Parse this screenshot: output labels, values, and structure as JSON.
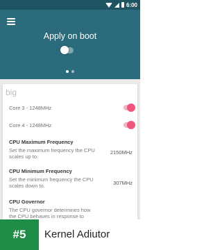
{
  "status_bar": {
    "time": "6:00"
  },
  "header": {
    "title": "Apply on boot"
  },
  "card": {
    "section_title": "big",
    "toggles": [
      {
        "label": "Core 3 - 1248MHz",
        "enabled": true
      },
      {
        "label": "Core 4 - 1248MHz",
        "enabled": true
      }
    ],
    "settings": [
      {
        "title": "CPU Maximum Frequency",
        "description": "Set the maximum frequency the CPU scales up to.",
        "value": "2150MHz"
      },
      {
        "title": "CPU Minimum Frequency",
        "description": "Set the minimum frequency the CPU scales down to.",
        "value": "307MHz"
      },
      {
        "title": "CPU Governor",
        "description": "The CPU governor determines how the CPU behaves in response to",
        "value": ""
      }
    ]
  },
  "banner": {
    "badge": "#5",
    "app_name": "Kernel Adiutor"
  },
  "colors": {
    "status_bar": "#1f5563",
    "header": "#2c6b7b",
    "accent": "#ef557d",
    "badge": "#1f8d46"
  }
}
